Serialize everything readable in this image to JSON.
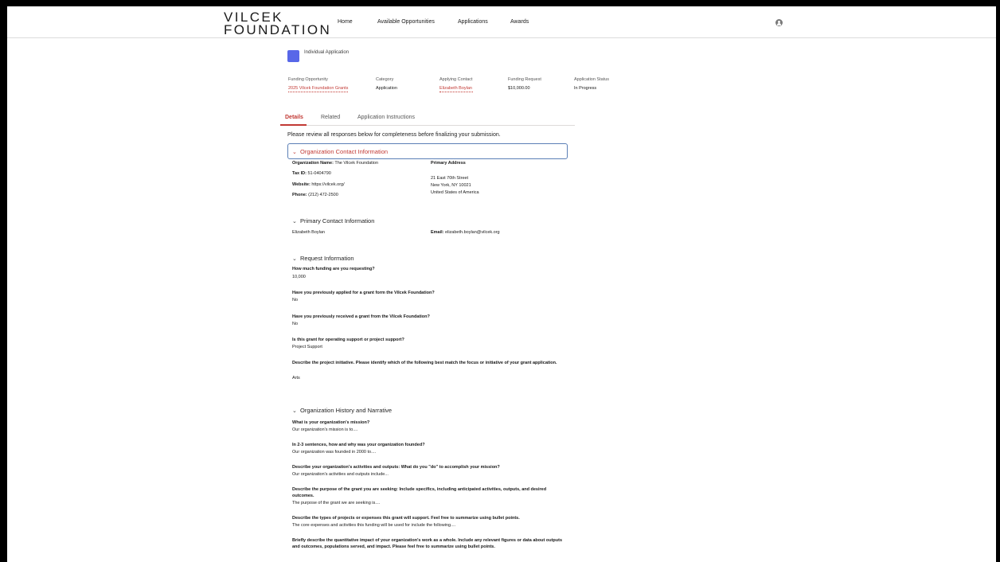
{
  "header": {
    "logo_line1": "VILCEK",
    "logo_line2": "FOUNDATION",
    "nav": [
      "Home",
      "Available Opportunities",
      "Applications",
      "Awards"
    ]
  },
  "record": {
    "title": "Individual Application",
    "fields": [
      {
        "label": "Funding Opportunity",
        "value": "2025 Vilcek Foundation Grants"
      },
      {
        "label": "Category",
        "value": "Application"
      },
      {
        "label": "Applying Contact",
        "value": "Elizabeth Boylan"
      },
      {
        "label": "Funding Request",
        "value": "$10,000.00"
      },
      {
        "label": "Application Status",
        "value": "In Progress"
      }
    ]
  },
  "tabs": [
    "Details",
    "Related",
    "Application Instructions"
  ],
  "review_text": "Please review all responses below for completeness before finalizing your submission.",
  "org_contact": {
    "heading": "Organization Contact Information",
    "name_label": "Organization Name:",
    "name_value": "The Vilcek Foundation",
    "tax_label": "Tax ID:",
    "tax_value": "51-0404790",
    "website_label": "Website:",
    "website_value": "https://vilcek.org/",
    "phone_label": "Phone:",
    "phone_value": "(212) 472-2500",
    "address_label": "Primary Address",
    "address_lines": [
      "21 East 70th Street",
      "New York, NY 10021",
      "United States of America"
    ]
  },
  "primary_contact": {
    "heading": "Primary Contact Information",
    "name": "Elizabeth Boylan",
    "email_label": "Email:",
    "email_value": "elizabeth.boylan@vilcek.org"
  },
  "request_info": {
    "heading": "Request Information",
    "items": [
      {
        "q": "How much funding are you requesting?",
        "a": "10,000"
      },
      {
        "q": "Have you previously applied for a grant form the Vilcek Foundation?",
        "a": "No"
      },
      {
        "q": "Have you previously received a grant from the Vilcek Foundation?",
        "a": "No"
      },
      {
        "q": "Is this grant for operating support or project support?",
        "a": "Project Support"
      },
      {
        "q": "Describe the project initiative. Please identify which of the following best match the focus or initiative of your grant application.",
        "a": "Arts"
      }
    ]
  },
  "history": {
    "heading": "Organization History and Narrative",
    "items": [
      {
        "q": "What is your organization's mission?",
        "a": "Our organization's mission is to...."
      },
      {
        "q": "In 2-3 sentences, how and why was your organization founded?",
        "a": "Our organization was founded in 2000 to...."
      },
      {
        "q": "Describe your organization's activities and outputs: What do you \"do\" to accomplish your mission?",
        "a": "Our organization's activities and outputs include..."
      },
      {
        "q": "Describe the purpose of the grant you are seeking: Include specifics, including anticipated activities, outputs, and desired outcomes.",
        "a": "The purpose of the grant we are seeking is...."
      },
      {
        "q": "Describe the types of projects or expenses this grant will support. Feel free to summarize using bullet points.",
        "a": "The core expenses and activities this funding will be used for include the following...."
      },
      {
        "q": "Briefly describe the quantitative impact of your organization's work as a whole. Include any relevant figures or data about outputs and outcomes, populations served, and impact. Please feel free to summarize using bullet points.",
        "a": ""
      }
    ]
  }
}
